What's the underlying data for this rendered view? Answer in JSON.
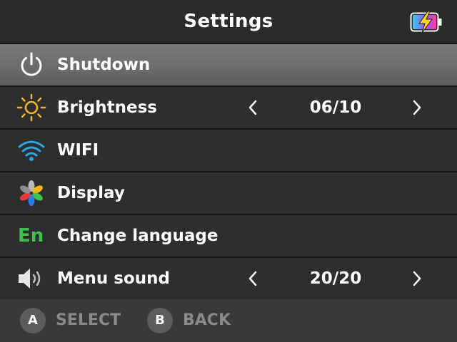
{
  "header": {
    "title": "Settings",
    "battery_icon": "battery-charging-icon"
  },
  "menu": {
    "items": [
      {
        "label": "Shutdown",
        "icon": "power-icon",
        "selected": true
      },
      {
        "label": "Brightness",
        "icon": "sun-icon",
        "value": "06/10"
      },
      {
        "label": "WIFI",
        "icon": "wifi-icon"
      },
      {
        "label": "Display",
        "icon": "pinwheel-icon"
      },
      {
        "label": "Change language",
        "icon": "En"
      },
      {
        "label": "Menu sound",
        "icon": "speaker-icon",
        "value": "20/20"
      }
    ]
  },
  "footer": {
    "select_key": "A",
    "select_label": "SELECT",
    "back_key": "B",
    "back_label": "BACK"
  },
  "colors": {
    "background": "#1f1f1f",
    "row": "#2e2e2e",
    "selected_row": "#6e6e6e",
    "sun": "#f5b81a",
    "wifi": "#2aa7e8",
    "language": "#3fc24b",
    "footer": "#3a3a3a",
    "hint_text": "#8a8a8a"
  }
}
